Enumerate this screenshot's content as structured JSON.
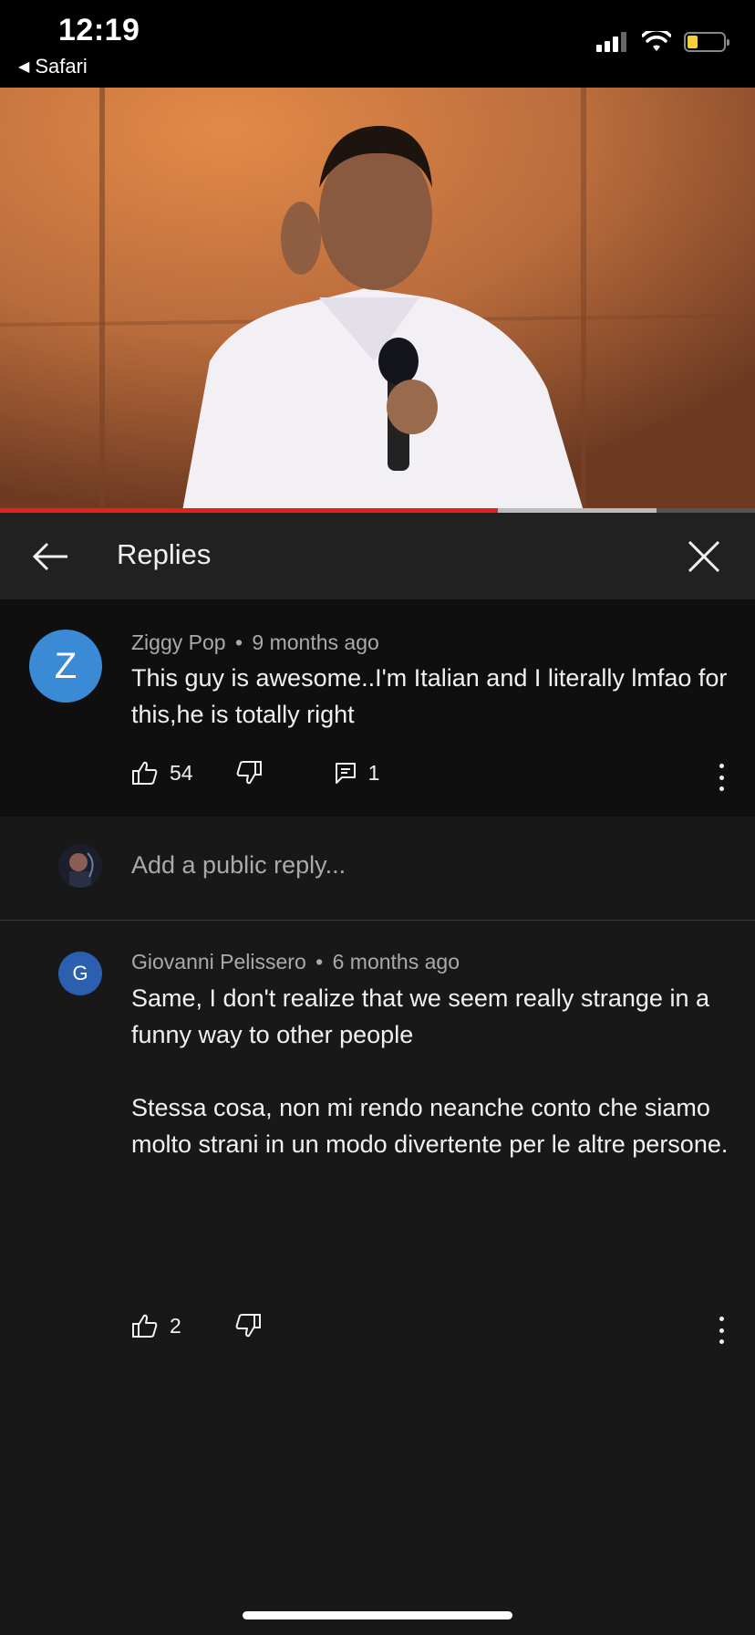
{
  "status_bar": {
    "time": "12:19",
    "back_app": "Safari",
    "icons": [
      "signal-icon",
      "wifi-icon",
      "battery-icon"
    ],
    "battery_level": 0.3
  },
  "video": {
    "progress_played": 0.66,
    "progress_buffered": 0.87,
    "colors": {
      "played": "#e62117",
      "buffered": "#bbbbbb"
    }
  },
  "header": {
    "title": "Replies",
    "back_icon": "arrow-left-icon",
    "close_icon": "close-icon"
  },
  "parent_comment": {
    "avatar_letter": "Z",
    "author": "Ziggy Pop",
    "separator": "•",
    "time": "9 months ago",
    "text": "This guy is awesome..I'm Italian and I literally lmfao for this,he is totally right",
    "likes": "54",
    "replies": "1"
  },
  "add_reply": {
    "placeholder": "Add a public reply..."
  },
  "reply": {
    "avatar_letter": "G",
    "author": "Giovanni Pelissero",
    "separator": "•",
    "time": "6 months ago",
    "text": "Same, I don't realize that we seem really strange in a funny way to other people\n\nStessa cosa, non mi rendo neanche conto che siamo molto strani in un modo divertente per le altre persone.",
    "likes": "2"
  },
  "colors": {
    "background": "#181818",
    "accent_avatar_z": "#3a8ad6",
    "accent_avatar_g": "#2c5fb0"
  }
}
